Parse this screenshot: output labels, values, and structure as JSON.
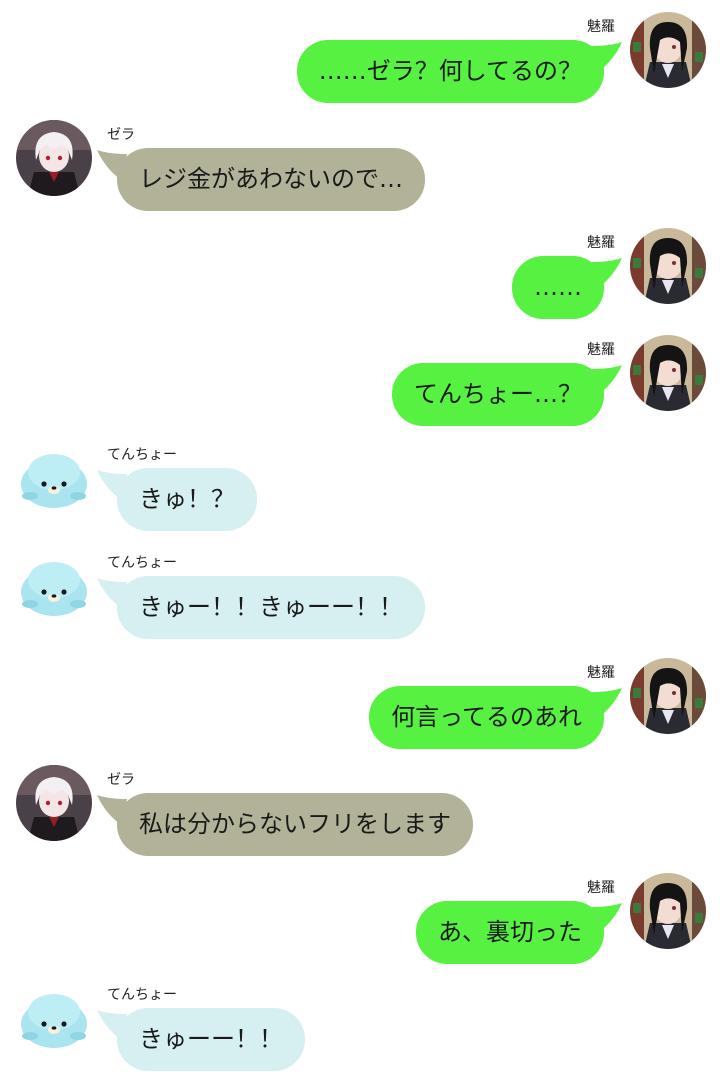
{
  "participants": {
    "mira": {
      "name": "魅羅",
      "avatar_icon": "girl-dark-hair-avatar-icon",
      "bubble_color": "#56f141"
    },
    "zera": {
      "name": "ゼラ",
      "avatar_icon": "white-hair-boy-avatar-icon",
      "bubble_color": "#b1b297"
    },
    "tencho": {
      "name": "てんちょー",
      "avatar_icon": "baby-seal-avatar-icon",
      "bubble_color": "#d6eff1"
    }
  },
  "messages": [
    {
      "side": "right",
      "sender": "魅羅",
      "text": "……ゼラ？何してるの？"
    },
    {
      "side": "left",
      "sender": "ゼラ",
      "text": "レジ金があわないので…"
    },
    {
      "side": "right",
      "sender": "魅羅",
      "text": "……"
    },
    {
      "side": "right",
      "sender": "魅羅",
      "text": "てんちょー…？"
    },
    {
      "side": "left",
      "sender": "てんちょー",
      "text": "きゅ！？"
    },
    {
      "side": "left",
      "sender": "てんちょー",
      "text": "きゅー！！きゅーー！！"
    },
    {
      "side": "right",
      "sender": "魅羅",
      "text": "何言ってるのあれ"
    },
    {
      "side": "left",
      "sender": "ゼラ",
      "text": "私は分からないフリをします"
    },
    {
      "side": "right",
      "sender": "魅羅",
      "text": "あ、裏切った"
    },
    {
      "side": "left",
      "sender": "てんちょー",
      "text": "きゅーー！！"
    }
  ]
}
